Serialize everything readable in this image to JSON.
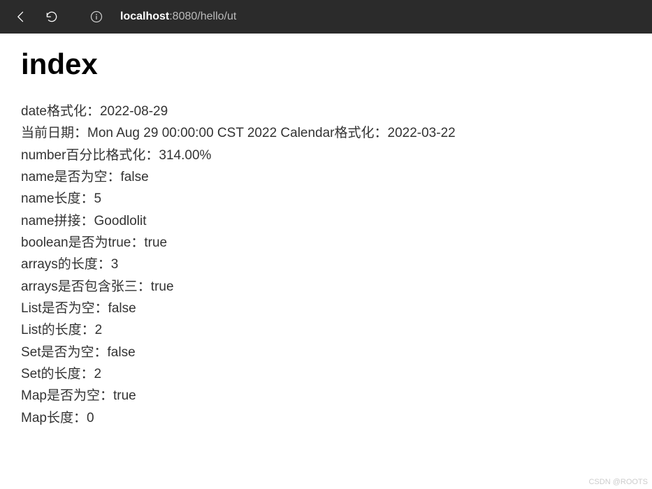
{
  "browser": {
    "url_host": "localhost",
    "url_port_path": ":8080/hello/ut"
  },
  "page": {
    "heading": "index",
    "lines": [
      "date格式化：2022-08-29",
      "当前日期：Mon Aug 29 00:00:00 CST 2022 Calendar格式化：2022-03-22",
      "number百分比格式化：314.00%",
      "name是否为空：false",
      "name长度：5",
      "name拼接：Goodlolit",
      "boolean是否为true：true",
      "arrays的长度：3",
      "arrays是否包含张三：true",
      "List是否为空：false",
      "List的长度：2",
      "Set是否为空：false",
      "Set的长度：2",
      "Map是否为空：true",
      "Map长度：0"
    ]
  },
  "watermark": "CSDN @ROOTS"
}
